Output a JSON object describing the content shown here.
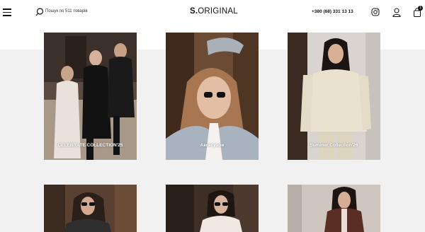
{
  "header": {
    "search_placeholder": "Пошук по 511 товарів",
    "logo_bold": "S.",
    "logo_rest": "ORIGINAL",
    "phone": "+380 (68) 331 13 13",
    "cart_count": "1"
  },
  "collections": [
    {
      "label": "CELEBRATE COLLECTION'25"
    },
    {
      "label": "Аксесуари"
    },
    {
      "label": "Summer Collection'26"
    }
  ],
  "colors": {
    "background": "#f1f1f1",
    "header": "#ffffff",
    "text": "#111111"
  }
}
